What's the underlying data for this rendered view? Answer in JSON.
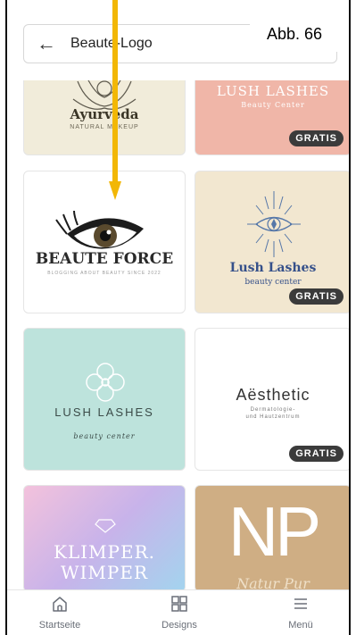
{
  "search": {
    "query": "Beaute-Logo"
  },
  "annotation": {
    "label": "Abb. 66"
  },
  "cards": {
    "ayurveda": {
      "title_a": "Ayur",
      "title_b": "veda",
      "sub": "NATURAL MAKEUP"
    },
    "lush1": {
      "title": "LUSH LASHES",
      "sub": "Beauty Center",
      "badge": "GRATIS"
    },
    "beaute": {
      "title": "BEAUTE FORCE",
      "sub": "BLOGGING ABOUT BEAUTY SINCE 2022"
    },
    "lush2": {
      "title": "Lush Lashes",
      "sub": "beauty center",
      "badge": "GRATIS"
    },
    "lush3": {
      "title": "LUSH LASHES",
      "sub": "beauty center"
    },
    "aesthetic": {
      "title": "Aësthetic",
      "sub1": "Dermatologie-",
      "sub2": "und Hautzentrum",
      "badge": "GRATIS"
    },
    "klimper": {
      "line1": "KLIMPER.",
      "line2": "WIMPER"
    },
    "np": {
      "title": "NP",
      "sub": "Natur Pur"
    }
  },
  "nav": {
    "home": "Startseite",
    "designs": "Designs",
    "menu": "Menü"
  },
  "colors": {
    "arrow": "#f2b705",
    "badge": "#3b3b3b"
  }
}
